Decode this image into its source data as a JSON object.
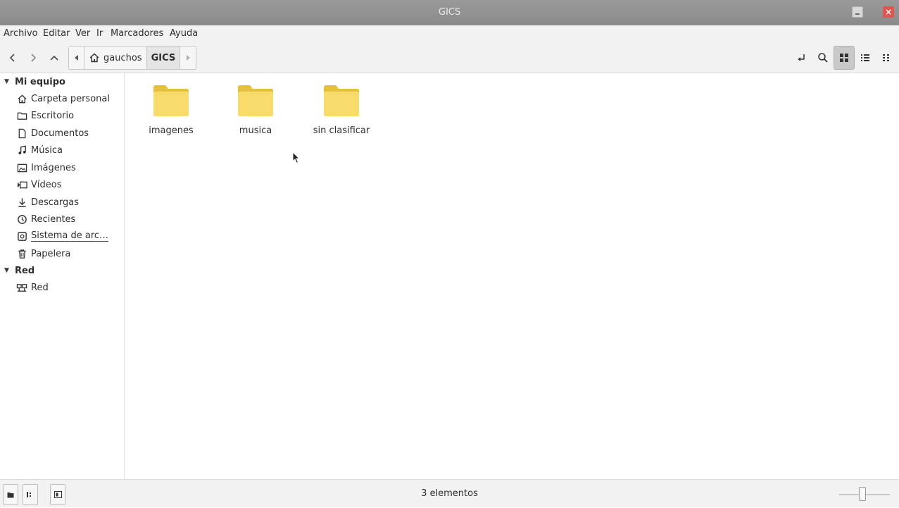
{
  "window": {
    "title": "GICS"
  },
  "menu": [
    "Archivo",
    "Editar",
    "Ver",
    "Ir",
    "Marcadores",
    "Ayuda"
  ],
  "breadcrumb": {
    "home": "gauchos",
    "current": "GICS"
  },
  "sidebar": {
    "sections": [
      {
        "label": "Mi equipo",
        "items": [
          {
            "label": "Carpeta personal",
            "icon": "home-icon"
          },
          {
            "label": "Escritorio",
            "icon": "desktop-folder-icon"
          },
          {
            "label": "Documentos",
            "icon": "document-icon"
          },
          {
            "label": "Música",
            "icon": "music-icon"
          },
          {
            "label": "Imágenes",
            "icon": "image-icon"
          },
          {
            "label": "Vídeos",
            "icon": "video-icon"
          },
          {
            "label": "Descargas",
            "icon": "download-icon"
          },
          {
            "label": "Recientes",
            "icon": "clock-icon"
          },
          {
            "label": "Sistema de arc…",
            "icon": "drive-icon"
          },
          {
            "label": "Papelera",
            "icon": "trash-icon"
          }
        ]
      },
      {
        "label": "Red",
        "items": [
          {
            "label": "Red",
            "icon": "network-icon"
          }
        ]
      }
    ]
  },
  "folders": [
    {
      "label": "imagenes"
    },
    {
      "label": "musica"
    },
    {
      "label": "sin clasificar"
    }
  ],
  "status": {
    "text": "3 elementos",
    "zoom_level": 0.45
  },
  "colors": {
    "folder": "#f5d75a",
    "titlebar": "#8f8f8f",
    "close": "#e0554f",
    "chrome": "#f2f2f2"
  }
}
